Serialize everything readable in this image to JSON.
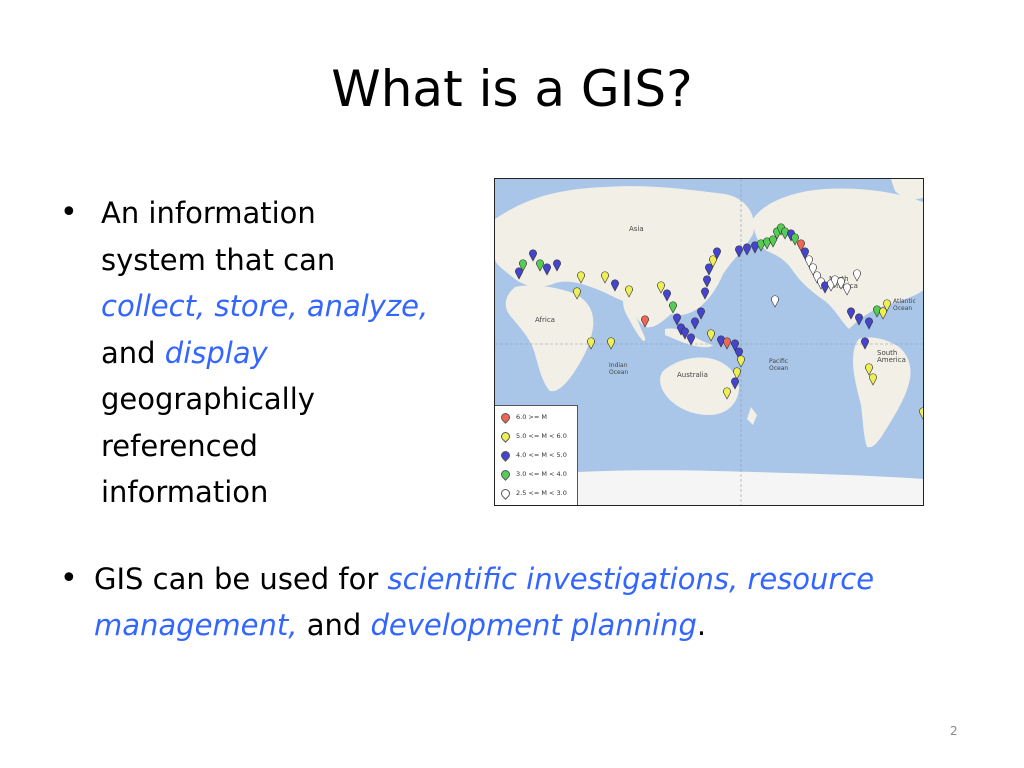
{
  "slide": {
    "title": "What is a GIS?",
    "page_number": "2"
  },
  "bullet1": {
    "line1": "An information",
    "line2": "system that can",
    "line3_highlight": "collect, store, analyze,",
    "line4_prefix": "and ",
    "line4_highlight": "display",
    "line5": "geographically",
    "line6": "referenced",
    "line7": "information"
  },
  "bullet2": {
    "prefix": "GIS can be used for ",
    "highlight1_line1": "scientific investigations, resource",
    "highlight1_line2": "management,",
    "middle": " and ",
    "highlight2": "development planning",
    "suffix": "."
  },
  "map": {
    "labels": {
      "asia": "Asia",
      "africa": "Africa",
      "indian_ocean_1": "Indian",
      "indian_ocean_2": "Ocean",
      "australia": "Australia",
      "pacific_ocean_1": "Pacific",
      "pacific_ocean_2": "Ocean",
      "north_america_1": "North",
      "north_america_2": "America",
      "atlantic_ocean_1": "Atlantic",
      "atlantic_ocean_2": "Ocean",
      "south_america_1": "South",
      "south_america_2": "America"
    },
    "legend": [
      {
        "label": "6.0 >= M",
        "color": "#ee6655"
      },
      {
        "label": "5.0 <= M < 6.0",
        "color": "#eeee55"
      },
      {
        "label": "4.0 <= M < 5.0",
        "color": "#4444cc"
      },
      {
        "label": "3.0 <= M < 4.0",
        "color": "#55cc55"
      },
      {
        "label": "2.5 <= M < 3.0",
        "color": "#ffffff"
      }
    ]
  },
  "colors": {
    "highlight": "#3366ff",
    "ocean": "#a9c6e8",
    "land": "#f2efe6"
  }
}
